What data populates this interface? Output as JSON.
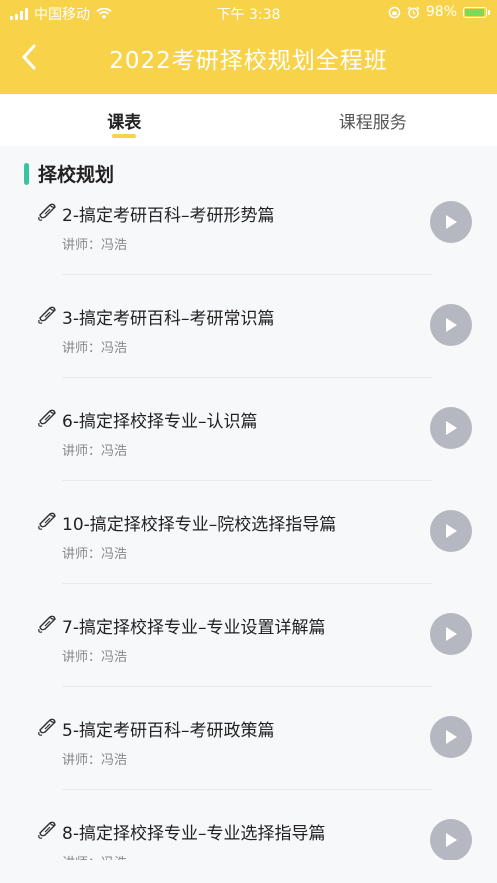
{
  "status_bar": {
    "carrier": "中国移动",
    "time": "下午 3:38",
    "battery_percent": "98%",
    "battery_level": 0.98,
    "battery_color": "#7ed957"
  },
  "nav": {
    "back_icon": "chevron-left-icon",
    "title": "2022考研择校规划全程班"
  },
  "tabs": [
    {
      "label": "课表",
      "active": true
    },
    {
      "label": "课程服务",
      "active": false
    }
  ],
  "section": {
    "title": "择校规划",
    "accent_color": "#39c3a0"
  },
  "lessons": [
    {
      "title": "2-搞定考研百科–考研形势篇",
      "teacher": "讲师：冯浩"
    },
    {
      "title": "3-搞定考研百科–考研常识篇",
      "teacher": "讲师：冯浩"
    },
    {
      "title": "6-搞定择校择专业–认识篇",
      "teacher": "讲师：冯浩"
    },
    {
      "title": "10-搞定择校择专业–院校选择指导篇",
      "teacher": "讲师：冯浩"
    },
    {
      "title": "7-搞定择校择专业–专业设置详解篇",
      "teacher": "讲师：冯浩"
    },
    {
      "title": "5-搞定考研百科–考研政策篇",
      "teacher": "讲师：冯浩"
    },
    {
      "title": "8-搞定择校择专业–专业选择指导篇",
      "teacher": "讲师：冯浩"
    }
  ],
  "colors": {
    "header": "#f8d34a",
    "play_button": "#b5b8c0"
  }
}
